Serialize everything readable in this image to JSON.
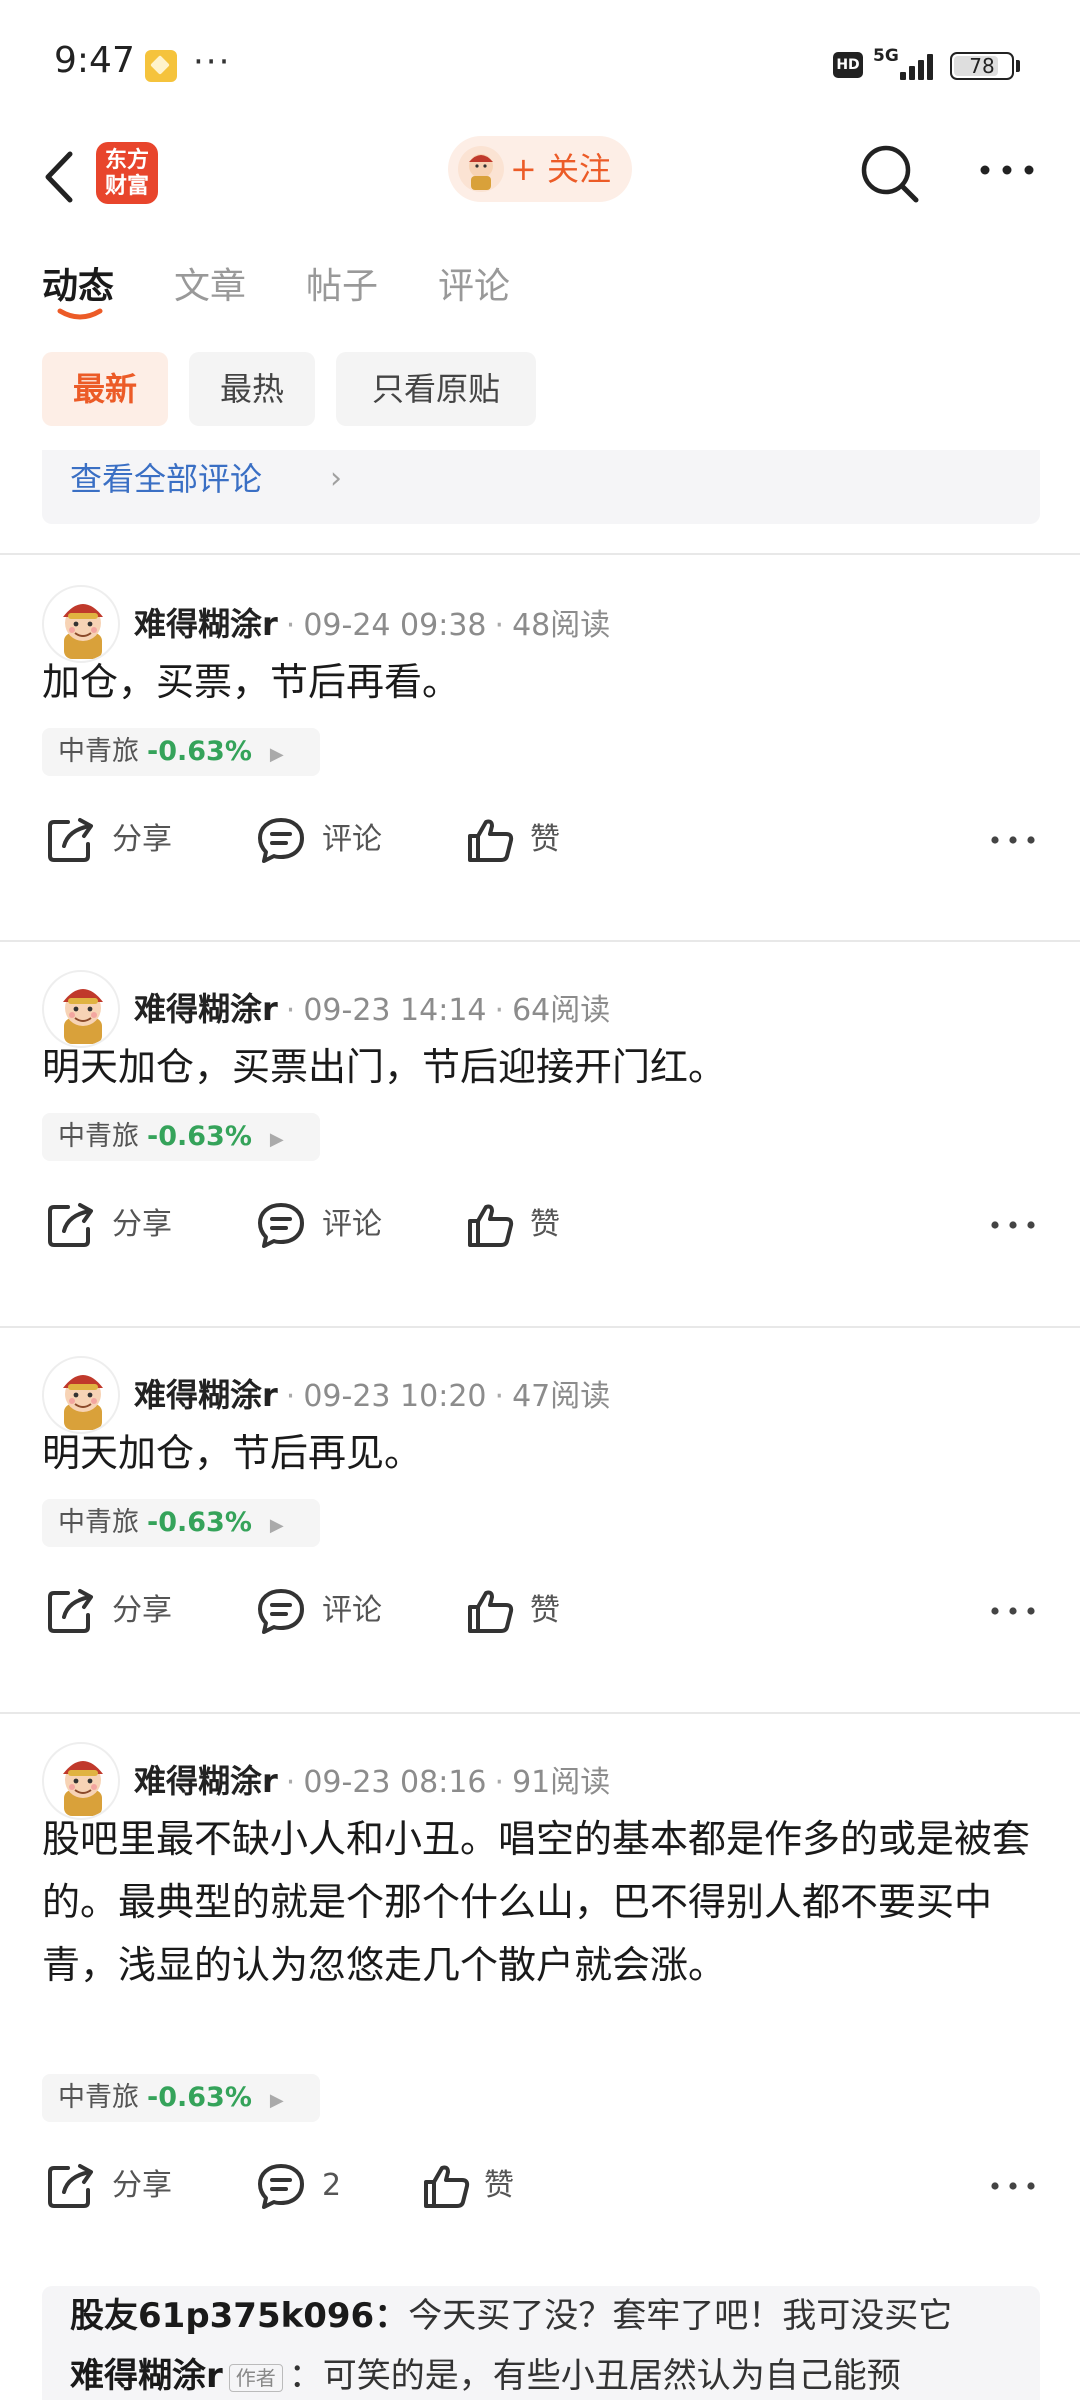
{
  "status_bar": {
    "time": "9:47",
    "more_dots": "···",
    "hd_label": "HD",
    "network": "5G",
    "battery": "78",
    "battery_level": 0.78
  },
  "header": {
    "logo_text_line1": "东方",
    "logo_text_line2": "财富",
    "follow_label": "+ 关注"
  },
  "tabs": [
    {
      "label": "动态",
      "active": true
    },
    {
      "label": "文章",
      "active": false
    },
    {
      "label": "帖子",
      "active": false
    },
    {
      "label": "评论",
      "active": false
    }
  ],
  "filters": [
    {
      "label": "最新",
      "active": true
    },
    {
      "label": "最热",
      "active": false
    },
    {
      "label": "只看原贴",
      "active": false
    }
  ],
  "view_all_comments": "查看全部评论",
  "view_all_chevron": "›",
  "posts": [
    {
      "username": "难得糊涂r",
      "time": "09-24 09:38",
      "reads": "48阅读",
      "text": "加仓，买票，节后再看。",
      "stock_name": "中青旅",
      "stock_change": "-0.63%",
      "share_label": "分享",
      "comment_label": "评论",
      "like_label": "赞"
    },
    {
      "username": "难得糊涂r",
      "time": "09-23 14:14",
      "reads": "64阅读",
      "text": "明天加仓，买票出门，节后迎接开门红。",
      "stock_name": "中青旅",
      "stock_change": "-0.63%",
      "share_label": "分享",
      "comment_label": "评论",
      "like_label": "赞"
    },
    {
      "username": "难得糊涂r",
      "time": "09-23 10:20",
      "reads": "47阅读",
      "text": "明天加仓，节后再见。",
      "stock_name": "中青旅",
      "stock_change": "-0.63%",
      "share_label": "分享",
      "comment_label": "评论",
      "like_label": "赞"
    },
    {
      "username": "难得糊涂r",
      "time": "09-23 08:16",
      "reads": "91阅读",
      "text": "股吧里最不缺小人和小丑。唱空的基本都是作多的或是被套的。最典型的就是个那个什么山，巴不得别人都不要买中青，浅显的认为忽悠走几个散户就会涨。",
      "stock_name": "中青旅",
      "stock_change": "-0.63%",
      "share_label": "分享",
      "comment_label": "2",
      "like_label": "赞"
    }
  ],
  "comment_preview": [
    {
      "user": "股友61p375k096：",
      "badge": "",
      "text": "今天买了没？套牢了吧！我可没买它"
    },
    {
      "user": "难得糊涂r",
      "badge": "作者",
      "text": "：可笑的是，有些小丑居然认为自己能预"
    }
  ],
  "colors": {
    "accent": "#ec5b27",
    "link_blue": "#3a6fc4",
    "stock_down_green": "#35a35a",
    "logo_red": "#e8452c"
  },
  "icons": [
    "back-icon",
    "app-logo",
    "search-icon",
    "more-icon",
    "share-icon",
    "comment-icon",
    "like-icon"
  ]
}
